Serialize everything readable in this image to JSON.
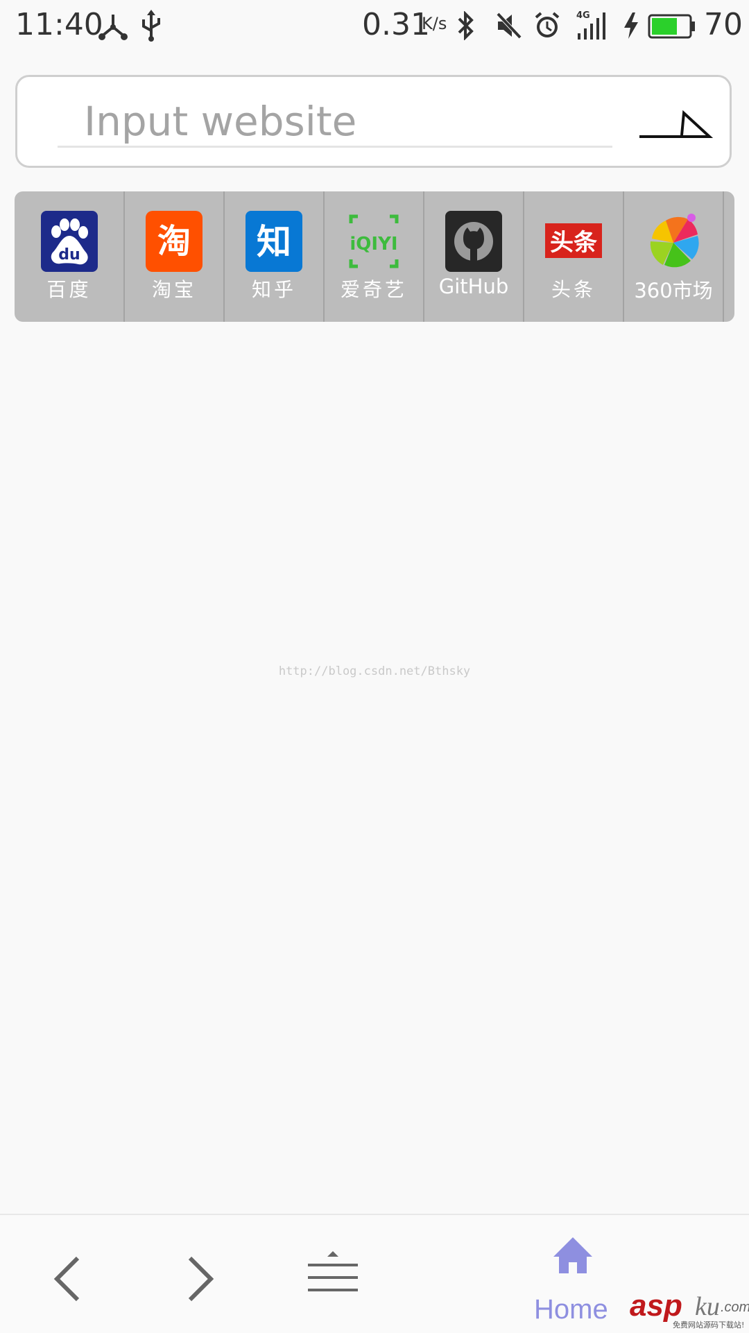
{
  "status_bar": {
    "time": "11:40",
    "speed": "0.31",
    "speed_unit": "K/s",
    "network": "4G",
    "battery": "70",
    "battery_level": 0.7,
    "battery_color": "#2bd02b",
    "icons": [
      "hub-icon",
      "usb-icon",
      "bluetooth-icon",
      "mute-icon",
      "alarm-icon",
      "signal-icon",
      "charging-icon",
      "battery-icon"
    ]
  },
  "url_bar": {
    "placeholder": "Input website",
    "value": "",
    "go_icon": "go-arrow-icon"
  },
  "shortcuts": [
    {
      "name": "百度",
      "icon": "baidu-icon",
      "color": "#2932e1"
    },
    {
      "name": "淘宝",
      "icon": "taobao-icon",
      "color": "#ff5000"
    },
    {
      "name": "知乎",
      "icon": "zhihu-icon",
      "color": "#0084ff"
    },
    {
      "name": "爱奇艺",
      "icon": "iqiyi-icon",
      "color": "#00be06"
    },
    {
      "name": "GitHub",
      "icon": "github-icon",
      "color": "#222222"
    },
    {
      "name": "头条",
      "icon": "toutiao-icon",
      "color": "#e0241d"
    },
    {
      "name": "360市场",
      "icon": "360-market-icon",
      "color": "#f2c400"
    }
  ],
  "watermark": "http://blog.csdn.net/Bthsky",
  "bottom_nav": {
    "back_icon": "chevron-left-icon",
    "forward_icon": "chevron-right-icon",
    "menu_icon": "menu-icon",
    "home_icon": "home-icon",
    "home_label": "Home",
    "home_color": "#8e8fe0"
  },
  "brand": {
    "asp": "asp",
    "ku": "ku",
    "com": ".com",
    "sub": "免费网站源码下载站!"
  }
}
